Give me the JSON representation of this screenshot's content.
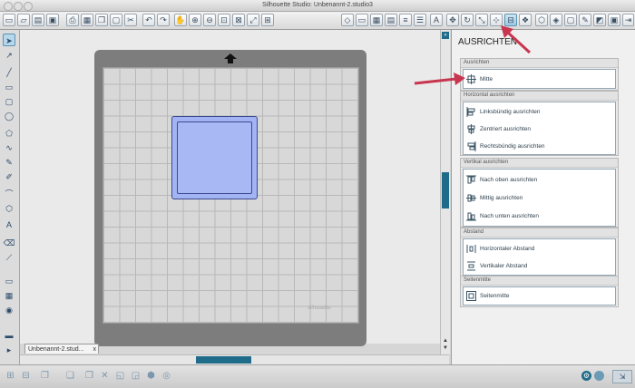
{
  "window": {
    "title": "Silhouette Studio: Unbenannt-2.studio3"
  },
  "document_tab": {
    "label": "Unbenannt-2.stud...",
    "close_symbol": "x"
  },
  "mat": {
    "watermark": "silhouette"
  },
  "panel": {
    "title": "AUSRICHTEN",
    "sections": [
      {
        "header": "Ausrichten",
        "items": [
          {
            "label": "Mitte",
            "icon": "align-center-icon"
          }
        ]
      },
      {
        "header": "Horizontal ausrichten",
        "items": [
          {
            "label": "Linksbündig ausrichten",
            "icon": "align-left-icon"
          },
          {
            "label": "Zentriert ausrichten",
            "icon": "align-hcenter-icon"
          },
          {
            "label": "Rechtsbündig ausrichten",
            "icon": "align-right-icon"
          }
        ]
      },
      {
        "header": "Vertikal ausrichten",
        "items": [
          {
            "label": "Nach oben ausrichten",
            "icon": "align-top-icon"
          },
          {
            "label": "Mittig ausrichten",
            "icon": "align-vcenter-icon"
          },
          {
            "label": "Nach unten ausrichten",
            "icon": "align-bottom-icon"
          }
        ]
      },
      {
        "header": "Abstand",
        "items": [
          {
            "label": "Horizontaler Abstand",
            "icon": "space-horizontal-icon"
          },
          {
            "label": "Vertikaler Abstand",
            "icon": "space-vertical-icon"
          }
        ]
      },
      {
        "header": "Seitenmitte",
        "items": [
          {
            "label": "Seitenmitte",
            "icon": "page-center-icon"
          }
        ]
      }
    ]
  },
  "toolbar": {
    "text_tool_glyph": "A",
    "expand_glyph": "»"
  },
  "colors": {
    "accent": "#1f6b8a",
    "shape_fill": "#a3b4f4",
    "shape_stroke": "#3a4a8e",
    "arrow": "#c8354e"
  }
}
